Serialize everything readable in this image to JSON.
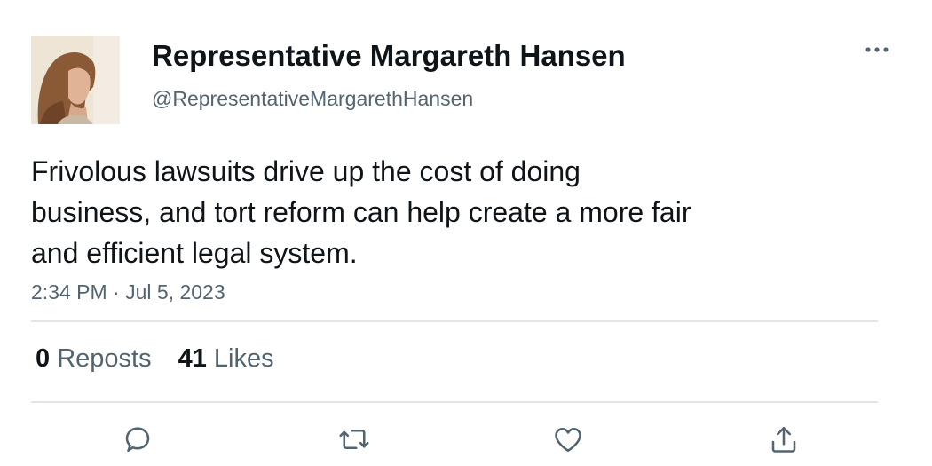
{
  "tweet": {
    "author": {
      "display_name": "Representative Margareth Hansen",
      "handle": "@RepresentativeMargarethHansen",
      "avatar": "profile-photo"
    },
    "text_lines": [
      "Frivolous lawsuits drive up the cost of doing",
      "business, and tort reform can help create a more fair",
      "and efficient legal system."
    ],
    "timestamp": "2:34 PM · Jul 5, 2023"
  },
  "stats": {
    "reposts": {
      "count": "0",
      "label": "Reposts"
    },
    "likes": {
      "count": "41",
      "label": "Likes"
    }
  },
  "actions": [
    {
      "name": "reply",
      "icon": "speech-bubble-icon"
    },
    {
      "name": "repost",
      "icon": "repost-arrows-icon"
    },
    {
      "name": "like",
      "icon": "heart-icon"
    },
    {
      "name": "share",
      "icon": "share-upload-icon"
    }
  ],
  "menu": {
    "icon": "more-dots-icon"
  },
  "colors": {
    "text_primary": "#0f1419",
    "text_secondary": "#536471",
    "divider": "#e3e6e8",
    "icon": "#536471"
  }
}
